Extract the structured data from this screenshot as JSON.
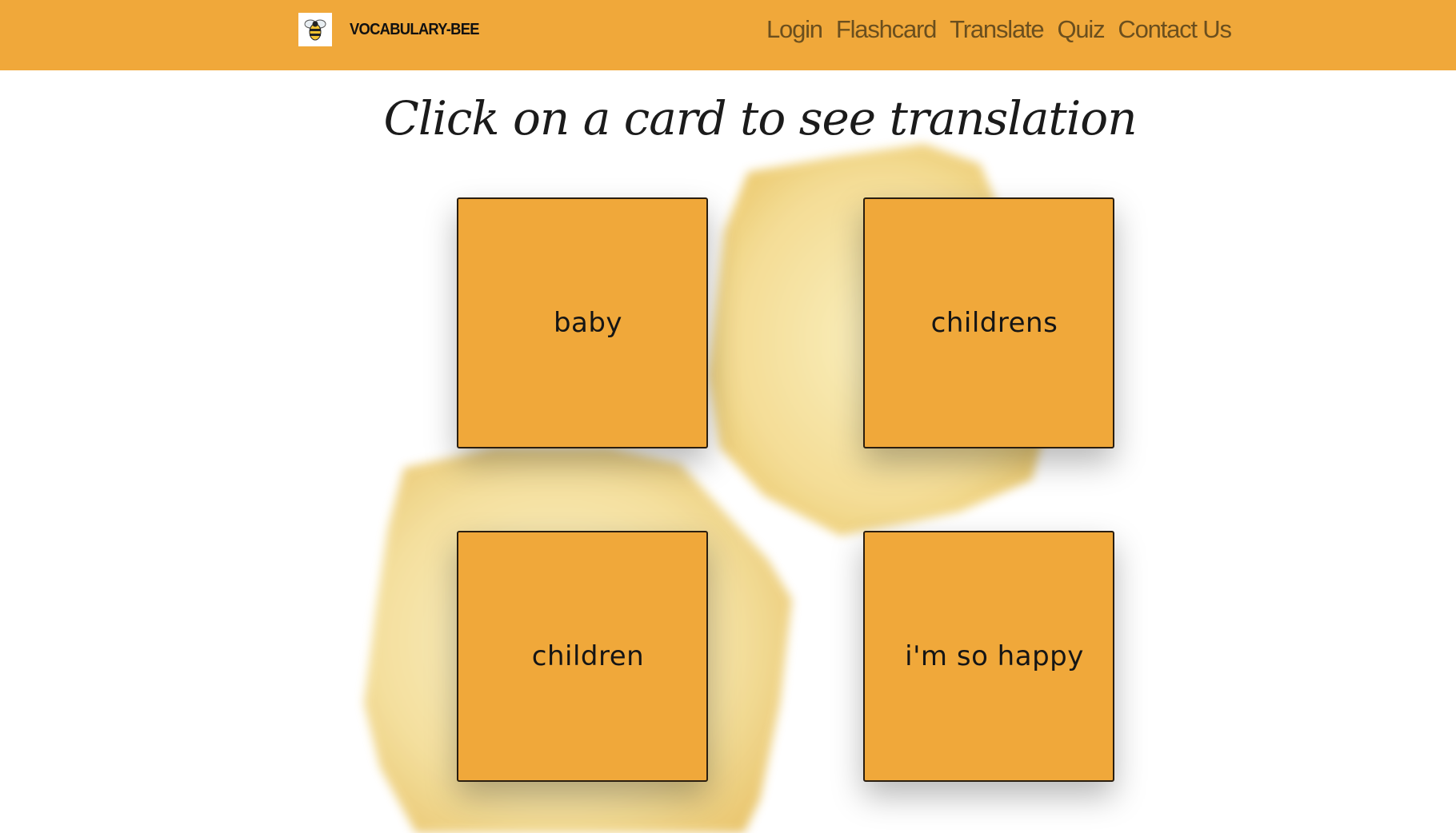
{
  "navbar": {
    "brand": "VOCABULARY-BEE",
    "logo_icon": "bee-icon",
    "links": [
      "Login",
      "Flashcard",
      "Translate",
      "Quiz",
      "Contact Us"
    ],
    "background_color": "#f0a83a",
    "link_color": "#6b4f1e"
  },
  "heading": "Click on a card to see translation",
  "cards": [
    {
      "text": "baby"
    },
    {
      "text": "childrens"
    },
    {
      "text": "children"
    },
    {
      "text": "i'm so happy"
    }
  ],
  "colors": {
    "card": "#f0a83a",
    "splash": "#f2d27a"
  }
}
